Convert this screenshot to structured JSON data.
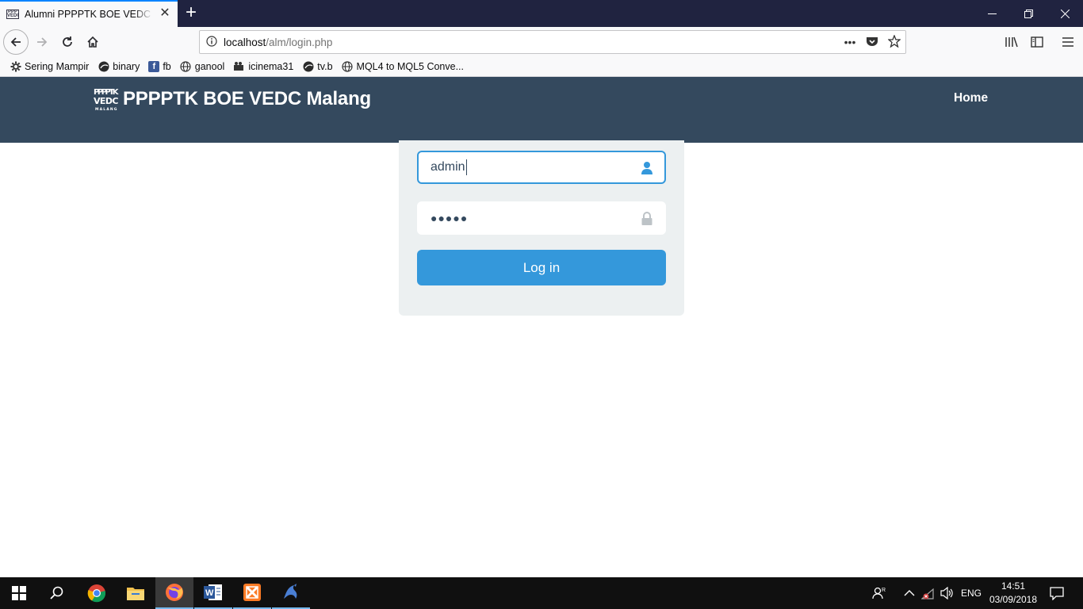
{
  "browser": {
    "tab_title": "Alumni PPPPTK BOE VEDC Malang",
    "tab_favicon_text": "PPPPTK VEDC",
    "url_host": "localhost",
    "url_path": "/alm/login.php",
    "bookmarks": [
      {
        "label": "Sering Mampir",
        "icon": "gear-icon"
      },
      {
        "label": "binary",
        "icon": "globe-swirl-icon"
      },
      {
        "label": "fb",
        "icon": "facebook-icon"
      },
      {
        "label": "ganool",
        "icon": "globe-icon"
      },
      {
        "label": "icinema31",
        "icon": "film-icon"
      },
      {
        "label": "tv.b",
        "icon": "globe-swirl-icon"
      },
      {
        "label": "MQL4 to MQL5 Conve...",
        "icon": "globe-icon"
      }
    ]
  },
  "site": {
    "logo_text": "PPPPTK VEDC MALANG",
    "brand_title": "PPPPTK BOE VEDC Malang",
    "nav_home": "Home"
  },
  "login": {
    "username_value": "admin",
    "password_mask": "●●●●●",
    "submit_label": "Log in"
  },
  "taskbar": {
    "language": "ENG",
    "time": "14:51",
    "date": "03/09/2018"
  },
  "colors": {
    "header_bg": "#34495e",
    "card_bg": "#ecf0f1",
    "accent": "#3498db"
  }
}
